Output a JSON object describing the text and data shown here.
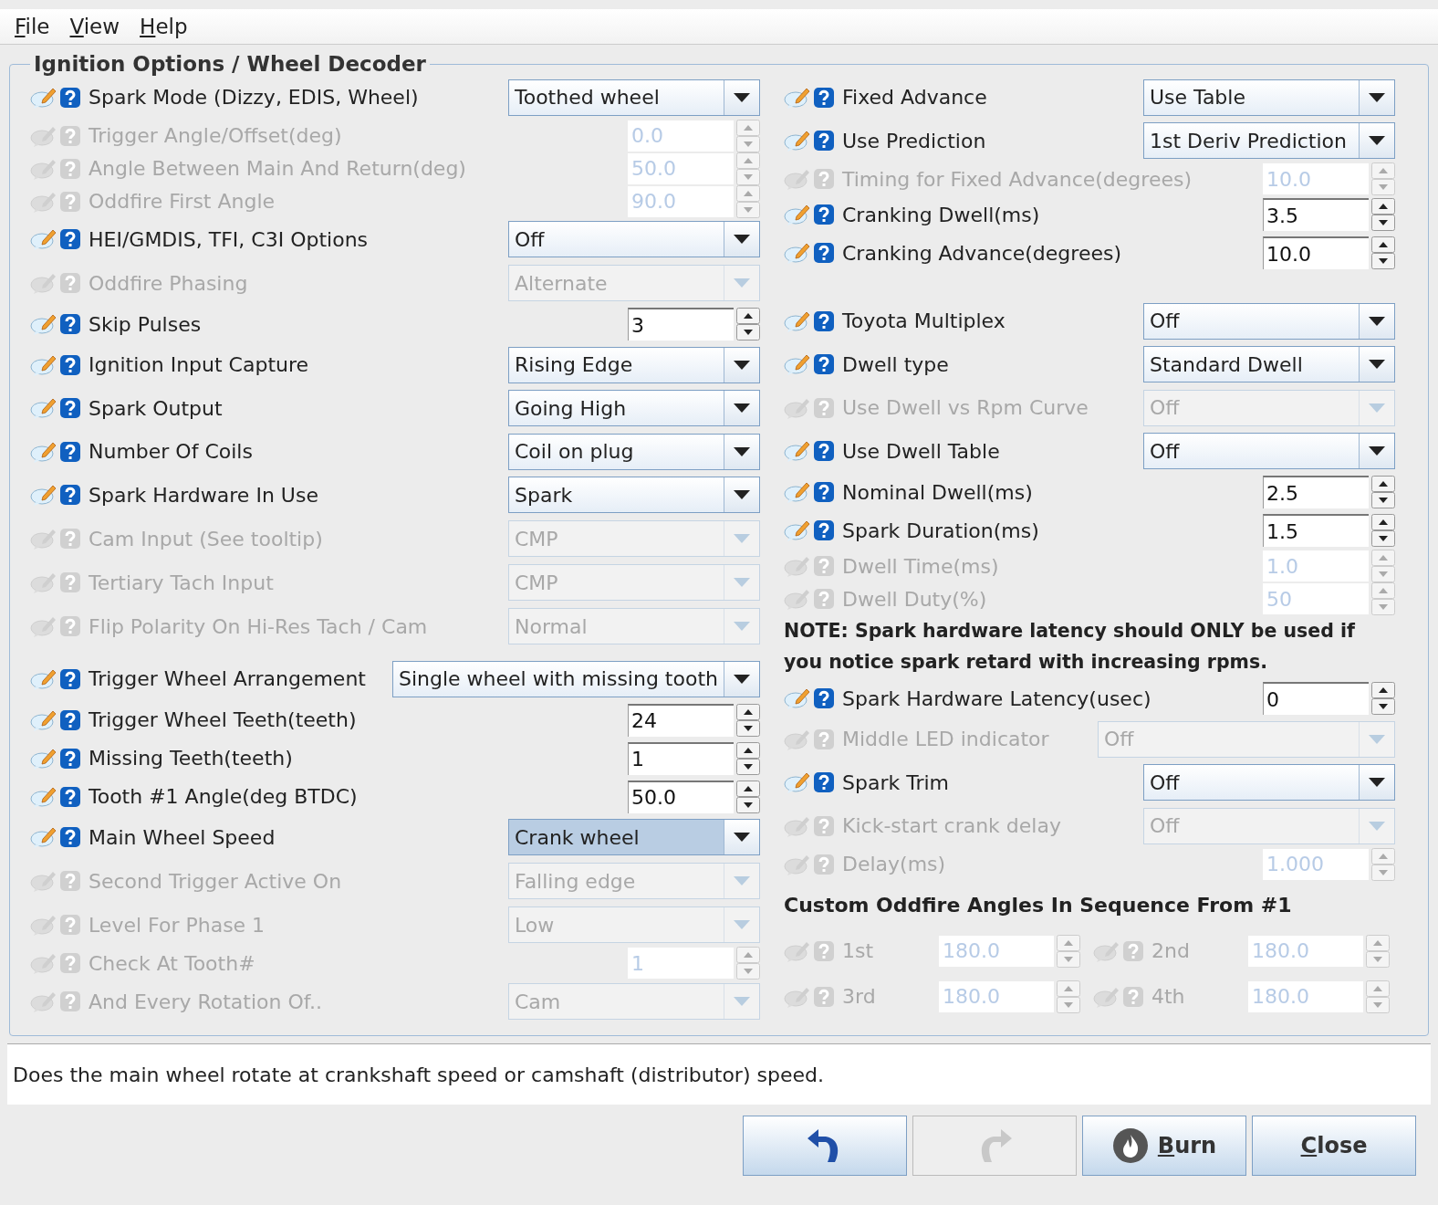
{
  "menu": [
    {
      "label": "File",
      "underline_first": true
    },
    {
      "label": "View",
      "underline_first": true
    },
    {
      "label": "Help",
      "underline_first": true
    }
  ],
  "panel": {
    "title": "Ignition Options / Wheel Decoder",
    "left": [
      {
        "kind": "combo",
        "enabled": true,
        "label": "Spark Mode (Dizzy, EDIS, Wheel)",
        "value": "Toothed wheel",
        "focused": false
      },
      {
        "kind": "spinner",
        "enabled": false,
        "label": "Trigger Angle/Offset(deg)",
        "value": "0.0"
      },
      {
        "kind": "spinner",
        "enabled": false,
        "label": "Angle Between Main And Return(deg)",
        "value": "50.0"
      },
      {
        "kind": "spinner",
        "enabled": false,
        "label": "Oddfire First Angle",
        "value": "90.0"
      },
      {
        "kind": "combo",
        "enabled": true,
        "label": "HEI/GMDIS, TFI, C3I Options",
        "value": "Off",
        "focused": false
      },
      {
        "kind": "combo",
        "enabled": false,
        "label": "Oddfire Phasing",
        "value": "Alternate",
        "focused": false
      },
      {
        "kind": "spinner",
        "enabled": true,
        "label": "Skip Pulses",
        "value": "3"
      },
      {
        "kind": "combo",
        "enabled": true,
        "label": "Ignition Input Capture",
        "value": "Rising Edge",
        "focused": false
      },
      {
        "kind": "combo",
        "enabled": true,
        "label": "Spark Output",
        "value": "Going High",
        "focused": false
      },
      {
        "kind": "combo",
        "enabled": true,
        "label": "Number Of Coils",
        "value": "Coil on plug",
        "focused": false
      },
      {
        "kind": "combo",
        "enabled": true,
        "label": "Spark Hardware In Use",
        "value": "Spark",
        "focused": false
      },
      {
        "kind": "combo",
        "enabled": false,
        "label": "Cam Input (See tooltip)",
        "value": "CMP",
        "focused": false
      },
      {
        "kind": "combo",
        "enabled": false,
        "label": "Tertiary Tach Input",
        "value": "CMP",
        "focused": false
      },
      {
        "kind": "combo",
        "enabled": false,
        "label": "Flip Polarity On Hi-Res Tach / Cam",
        "value": "Normal",
        "focused": false
      },
      {
        "kind": "gap"
      },
      {
        "kind": "combo",
        "enabled": true,
        "label": "Trigger Wheel Arrangement",
        "value": "Single wheel with missing tooth",
        "focused": false
      },
      {
        "kind": "spinner",
        "enabled": true,
        "label": "Trigger Wheel Teeth(teeth)",
        "value": "24"
      },
      {
        "kind": "spinner",
        "enabled": true,
        "label": "Missing Teeth(teeth)",
        "value": "1"
      },
      {
        "kind": "spinner",
        "enabled": true,
        "label": "Tooth #1 Angle(deg BTDC)",
        "value": "50.0"
      },
      {
        "kind": "combo",
        "enabled": true,
        "label": "Main Wheel Speed",
        "value": "Crank wheel",
        "focused": true
      },
      {
        "kind": "combo",
        "enabled": false,
        "label": "Second Trigger Active On",
        "value": "Falling edge",
        "focused": false
      },
      {
        "kind": "combo",
        "enabled": false,
        "label": "Level For Phase 1",
        "value": "Low",
        "focused": false
      },
      {
        "kind": "spinner",
        "enabled": false,
        "label": "Check At Tooth#",
        "value": "1"
      },
      {
        "kind": "combo",
        "enabled": false,
        "label": "And Every Rotation Of..",
        "value": "Cam",
        "focused": false
      }
    ],
    "right": [
      {
        "kind": "combo",
        "enabled": true,
        "label": "Fixed Advance",
        "value": "Use Table",
        "focused": false
      },
      {
        "kind": "combo",
        "enabled": true,
        "label": "Use Prediction",
        "value": "1st Deriv Prediction",
        "focused": false
      },
      {
        "kind": "spinner",
        "enabled": false,
        "label": "Timing for Fixed Advance(degrees)",
        "value": "10.0"
      },
      {
        "kind": "spinner",
        "enabled": true,
        "label": "Cranking Dwell(ms)",
        "value": "3.5"
      },
      {
        "kind": "spinner",
        "enabled": true,
        "label": "Cranking Advance(degrees)",
        "value": "10.0"
      },
      {
        "kind": "gap"
      },
      {
        "kind": "combo",
        "enabled": true,
        "label": "Toyota Multiplex",
        "value": "Off",
        "focused": false
      },
      {
        "kind": "combo",
        "enabled": true,
        "label": "Dwell type",
        "value": "Standard Dwell",
        "focused": false
      },
      {
        "kind": "combo",
        "enabled": false,
        "label": "Use Dwell vs Rpm Curve",
        "value": "Off",
        "focused": false
      },
      {
        "kind": "combo",
        "enabled": true,
        "label": "Use Dwell Table",
        "value": "Off",
        "focused": false
      },
      {
        "kind": "spinner",
        "enabled": true,
        "label": "Nominal Dwell(ms)",
        "value": "2.5"
      },
      {
        "kind": "spinner",
        "enabled": true,
        "label": "Spark Duration(ms)",
        "value": "1.5"
      },
      {
        "kind": "spinner",
        "enabled": false,
        "label": "Dwell Time(ms)",
        "value": "1.0"
      },
      {
        "kind": "spinner",
        "enabled": false,
        "label": "Dwell Duty(%)",
        "value": "50"
      },
      {
        "kind": "note",
        "text": "NOTE: Spark hardware latency should ONLY be used if you notice spark retard with increasing rpms."
      },
      {
        "kind": "spinner",
        "enabled": true,
        "label": "Spark Hardware Latency(usec)",
        "value": "0"
      },
      {
        "kind": "combo",
        "enabled": false,
        "label": "Middle LED indicator",
        "value": "Off",
        "focused": false,
        "wide": true
      },
      {
        "kind": "combo",
        "enabled": true,
        "label": "Spark Trim",
        "value": "Off",
        "focused": false
      },
      {
        "kind": "combo",
        "enabled": false,
        "label": "Kick-start crank delay",
        "value": "Off",
        "focused": false
      },
      {
        "kind": "spinner",
        "enabled": false,
        "label": "Delay(ms)",
        "value": "1.000"
      },
      {
        "kind": "heading",
        "text": "Custom Oddfire Angles In Sequence From #1"
      },
      {
        "kind": "pair",
        "items": [
          {
            "enabled": false,
            "label": "1st",
            "value": "180.0"
          },
          {
            "enabled": false,
            "label": "2nd",
            "value": "180.0"
          }
        ]
      },
      {
        "kind": "pair",
        "items": [
          {
            "enabled": false,
            "label": "3rd",
            "value": "180.0"
          },
          {
            "enabled": false,
            "label": "4th",
            "value": "180.0"
          }
        ]
      }
    ]
  },
  "help_text": "Does the main wheel rotate at crankshaft speed or camshaft (distributor) speed.",
  "buttons": [
    {
      "kind": "undo",
      "enabled": true
    },
    {
      "kind": "redo",
      "enabled": false
    },
    {
      "kind": "burn",
      "enabled": true,
      "label": "Burn",
      "underline_first": true
    },
    {
      "kind": "close",
      "enabled": true,
      "label": "Close",
      "underline_first": true
    }
  ]
}
